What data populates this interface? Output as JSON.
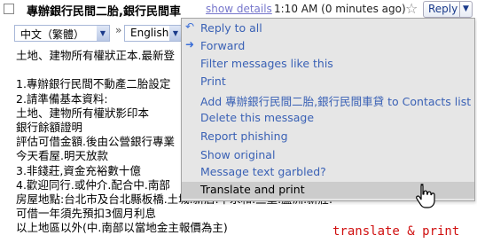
{
  "header": {
    "subject": "專辦銀行民間二胎,銀行民間車",
    "show_details": "show details",
    "timestamp": "1:10 AM (0 minutes ago)",
    "reply_label": "Reply"
  },
  "translate_bar": {
    "source_language": "中文（繁體）",
    "target_language": "English"
  },
  "body_lines": [
    "土地、建物所有權狀正本.最新登",
    "",
    "1.專辦銀行民間不動產二胎設定",
    "2.請準備基本資料:",
    "土地、建物所有權狀影印本",
    "銀行餘額證明",
    "評估可借金額.後由公營銀行專業",
    "今天看屋.明天放款",
    "3.非錢莊,資金充裕數十億",
    "4.歡迎同行.或仲介.配合中.南部",
    "房屋地點:台北市及台北縣板橋.土城.新店.中永和.三重.蘆洲.新莊.",
    "可借一年須先預扣3個月利息",
    "以上地區以外(中.南部以當地金主報價為主)"
  ],
  "menu": {
    "items": [
      {
        "label": "Reply to all",
        "icon": "reply-all-icon"
      },
      {
        "label": "Forward",
        "icon": "forward-icon"
      },
      {
        "label": "Filter messages like this"
      },
      {
        "label": "Print"
      },
      {
        "label": "Add 專辦銀行民間二胎,銀行民間車貸 to Contacts list"
      },
      {
        "label": "Delete this message"
      },
      {
        "label": "Report phishing"
      },
      {
        "label": "Show original"
      },
      {
        "label": "Message text garbled?"
      },
      {
        "label": "Translate and print",
        "highlighted": true
      }
    ]
  },
  "annotation": "translate & print",
  "colors": {
    "link": "#3a61b5",
    "annotation": "#d01010",
    "menu_bg": "#e6e6e6",
    "menu_hover": "#cccccc"
  }
}
